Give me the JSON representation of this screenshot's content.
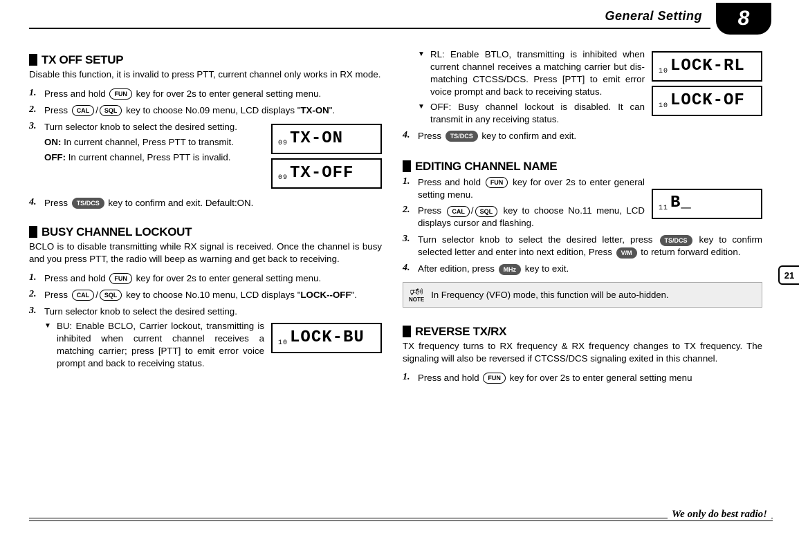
{
  "header": {
    "category": "General Setting",
    "chapter": "8",
    "page_side": "21"
  },
  "keys": {
    "FUN": "FUN",
    "CAL": "CAL",
    "SQL": "SQL",
    "TSDCS": "TS/DCS",
    "VM": "V/M",
    "MHZ": "MHz"
  },
  "tx_off": {
    "title": "TX OFF SETUP",
    "intro": "Disable this function, it is invalid to press PTT, current channel only works in RX mode.",
    "s1": "Press and hold ",
    "s1b": " key for over 2s to enter general setting menu.",
    "s2a": "Press ",
    "s2b": " key to choose No.09 menu, LCD displays \"",
    "s2c": "TX-ON",
    "s2d": "\".",
    "s3": "Turn selector knob to select the desired setting.",
    "s3_on_l": "ON:",
    "s3_on": " In current channel, Press PTT to transmit.",
    "s3_off_l": "OFF:",
    "s3_off": " In current channel, Press PTT is invalid.",
    "s4a": "Press ",
    "s4b": " key to confirm and exit. Default:ON.",
    "lcd1": {
      "idx": "09",
      "txt": "TX-ON"
    },
    "lcd2": {
      "idx": "09",
      "txt": "TX-OFF"
    }
  },
  "bclo": {
    "title": "BUSY CHANNEL LOCKOUT",
    "intro": "BCLO is to disable transmitting while RX signal is received. Once the channel is busy and you press PTT, the radio will beep as warning and get back to receiving.",
    "s1": "Press and hold ",
    "s1b": " key for over 2s to enter general setting menu.",
    "s2a": "Press ",
    "s2b": " key to choose No.10 menu, LCD displays \"",
    "s2c": "LOCK--OFF",
    "s2d": "\".",
    "s3": "Turn selector knob to select the desired setting.",
    "bu": "BU: Enable BCLO, Carrier lockout, transmitting is inhibited when current channel receives a matching carrier; press [PTT] to emit error voice prompt and back to receiving status.",
    "rl": "RL: Enable BTLO, transmitting is inhibited when current channel receives a matching carrier but dis-matching CTCSS/DCS. Press [PTT] to emit error voice prompt and back to receiving status.",
    "off": "OFF: Busy channel lockout is disabled. It can transmit in any receiving status.",
    "s4a": "Press ",
    "s4b": " key to confirm and exit.",
    "lcd_bu": {
      "idx": "10",
      "txt": "LOCK-BU"
    },
    "lcd_rl": {
      "idx": "10",
      "txt": "LOCK-RL"
    },
    "lcd_of": {
      "idx": "10",
      "txt": "LOCK-OF"
    }
  },
  "edit_name": {
    "title": "EDITING CHANNEL NAME",
    "s1": "Press and hold ",
    "s1b": " key for over 2s to enter general setting menu.",
    "s2a": "Press ",
    "s2b": " key to choose No.11 menu, LCD displays cursor and flashing.",
    "s3a": "Turn selector knob to select the desired letter, press ",
    "s3b": " key to confirm selected letter and enter into next edition, Press ",
    "s3c": " to return forward edition.",
    "s4a": "After edition, press ",
    "s4b": " key to exit.",
    "lcd": {
      "idx": "11",
      "txt": "B_"
    },
    "note": "In Frequency (VFO) mode, this function will be auto-hidden.",
    "note_label": "NOTE"
  },
  "reverse": {
    "title": "REVERSE TX/RX",
    "intro": "TX frequency turns to RX frequency & RX frequency changes to TX frequency. The signaling will also be reversed if CTCSS/DCS signaling exited in this channel.",
    "s1": "Press and hold ",
    "s1b": " key for over 2s to enter general setting menu"
  },
  "footer": {
    "slogan": "We only do best radio!"
  }
}
